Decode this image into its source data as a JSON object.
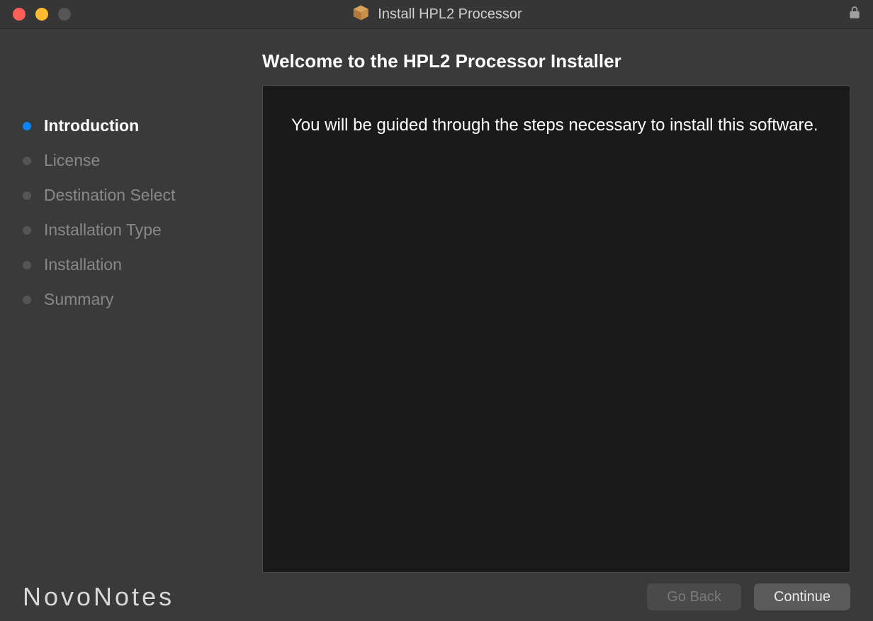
{
  "window": {
    "title": "Install HPL2 Processor"
  },
  "header": {
    "heading": "Welcome to the HPL2 Processor Installer"
  },
  "sidebar": {
    "steps": [
      {
        "label": "Introduction",
        "active": true
      },
      {
        "label": "License",
        "active": false
      },
      {
        "label": "Destination Select",
        "active": false
      },
      {
        "label": "Installation Type",
        "active": false
      },
      {
        "label": "Installation",
        "active": false
      },
      {
        "label": "Summary",
        "active": false
      }
    ]
  },
  "main": {
    "body_text": "You will be guided through the steps necessary to install this software."
  },
  "footer": {
    "brand": "NovoNotes",
    "go_back_label": "Go Back",
    "continue_label": "Continue"
  }
}
